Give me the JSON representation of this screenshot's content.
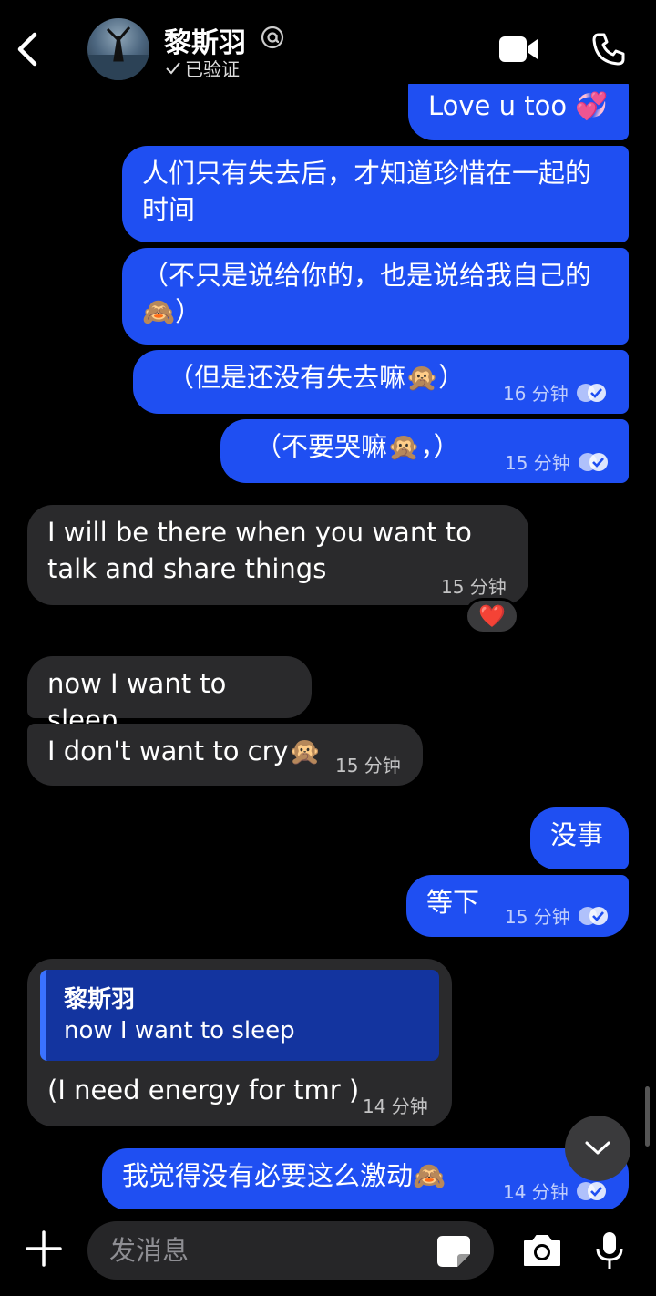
{
  "header": {
    "contact_name": "黎斯羽",
    "verified_label": "已验证"
  },
  "messages": [
    {
      "text": "Love u too 💞"
    },
    {
      "text": "人们只有失去后，才知道珍惜在一起的时间"
    },
    {
      "text": "（不只是说给你的，也是说给我自己的🙈）"
    },
    {
      "text": "（但是还没有失去嘛🙊）",
      "time": "16 分钟"
    },
    {
      "text": "（不要哭嘛🙊，）",
      "time": "15 分钟"
    },
    {
      "text": "I will be there when you want to talk and share things",
      "time": "15 分钟",
      "reaction": "❤️"
    },
    {
      "text": "now I want to sleep"
    },
    {
      "text": "I don't want to cry🙊",
      "time": "15 分钟"
    },
    {
      "text": "没事"
    },
    {
      "text": "等下",
      "time": "15 分钟"
    },
    {
      "reply_to_name": "黎斯羽",
      "reply_to_text": "now I want to sleep",
      "text": "(I need energy for tmr )",
      "time": "14 分钟"
    },
    {
      "text": "我觉得没有必要这么激动🙈",
      "time": "14 分钟"
    }
  ],
  "composer": {
    "placeholder": "发消息"
  },
  "colors": {
    "outgoing_bubble": "#1f4ff2",
    "incoming_bubble": "#2a2a2c",
    "reply_card": "#13349f"
  },
  "icons": [
    "back-arrow-icon",
    "at-icon",
    "check-icon",
    "video-camera-icon",
    "phone-icon",
    "read-receipt-icon",
    "chevron-down-icon",
    "plus-icon",
    "sticker-icon",
    "camera-icon",
    "microphone-icon"
  ]
}
